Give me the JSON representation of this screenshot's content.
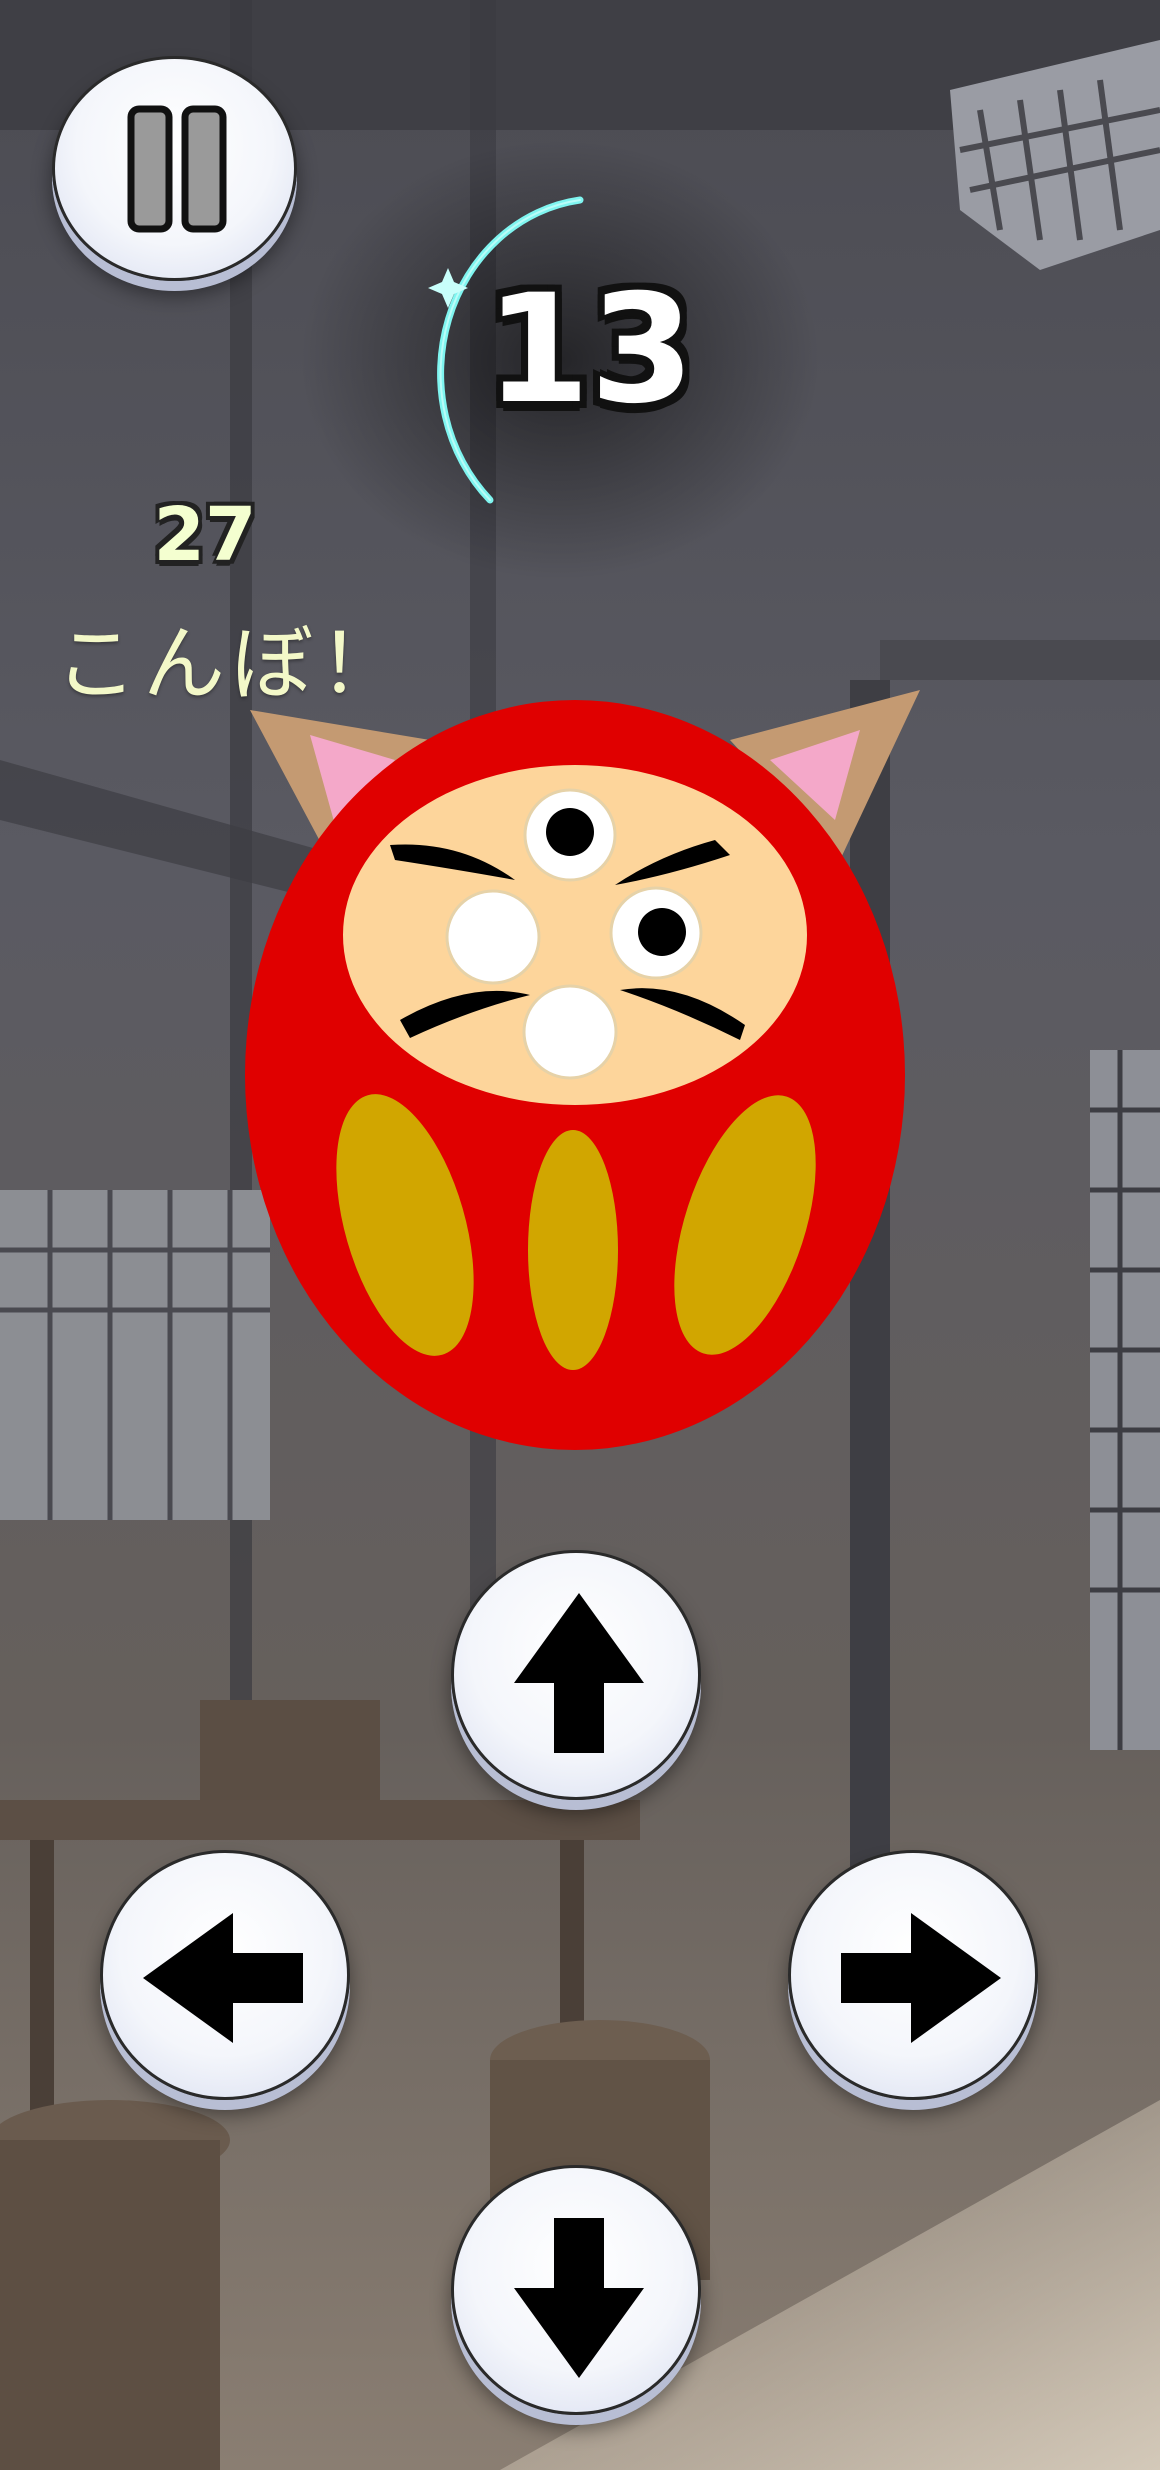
{
  "hud": {
    "score": "13",
    "combo_count": "27",
    "combo_label": "こんぼ！",
    "timer_color": "#7ff5f0"
  },
  "buttons": {
    "pause": "pause-icon",
    "up": "arrow-up-icon",
    "left": "arrow-left-icon",
    "right": "arrow-right-icon",
    "down": "arrow-down-icon"
  },
  "character": {
    "name": "daruma-cat",
    "body_color": "#e00000",
    "face_color": "#fdd59b",
    "belly_color": "#d1a600",
    "ear_color": "#c49a72",
    "inner_ear_color": "#f4a8c9"
  }
}
